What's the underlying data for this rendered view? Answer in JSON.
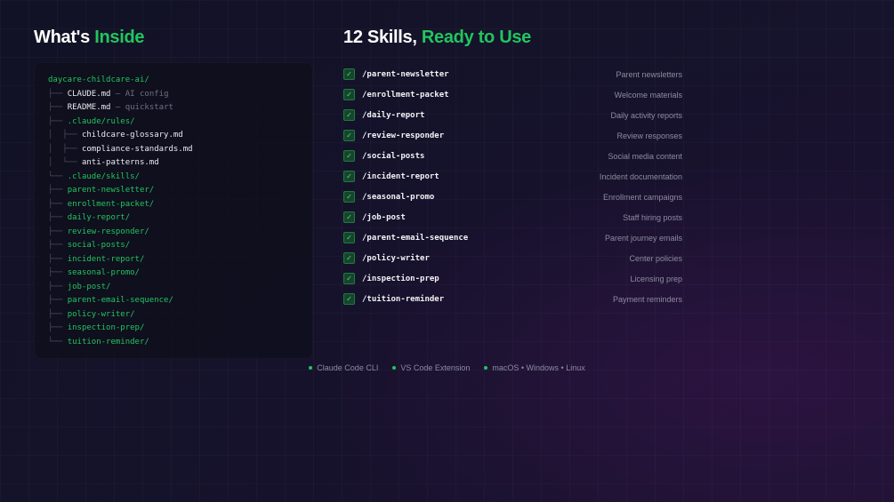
{
  "left_heading": {
    "plain": "What's",
    "accent": "Inside"
  },
  "right_heading": {
    "plain": "12 Skills,",
    "accent": "Ready to Use"
  },
  "tree": [
    {
      "prefix": "",
      "name": "daycare-childcare-ai/",
      "comment": "",
      "style": "root"
    },
    {
      "prefix": "├── ",
      "name": "CLAUDE.md",
      "comment": " — AI config",
      "style": "white"
    },
    {
      "prefix": "├── ",
      "name": "README.md",
      "comment": " — quickstart",
      "style": "white"
    },
    {
      "prefix": "├── ",
      "name": ".claude/rules/",
      "comment": "",
      "style": "green"
    },
    {
      "prefix": "│  ├── ",
      "name": "childcare-glossary.md",
      "comment": "",
      "style": "white"
    },
    {
      "prefix": "│  ├── ",
      "name": "compliance-standards.md",
      "comment": "",
      "style": "white"
    },
    {
      "prefix": "│  └── ",
      "name": "anti-patterns.md",
      "comment": "",
      "style": "white"
    },
    {
      "prefix": "└── ",
      "name": ".claude/skills/",
      "comment": "",
      "style": "green"
    },
    {
      "prefix": "├── ",
      "name": "parent-newsletter/",
      "comment": "",
      "style": "green"
    },
    {
      "prefix": "├── ",
      "name": "enrollment-packet/",
      "comment": "",
      "style": "green"
    },
    {
      "prefix": "├── ",
      "name": "daily-report/",
      "comment": "",
      "style": "green"
    },
    {
      "prefix": "├── ",
      "name": "review-responder/",
      "comment": "",
      "style": "green"
    },
    {
      "prefix": "├── ",
      "name": "social-posts/",
      "comment": "",
      "style": "green"
    },
    {
      "prefix": "├── ",
      "name": "incident-report/",
      "comment": "",
      "style": "green"
    },
    {
      "prefix": "├── ",
      "name": "seasonal-promo/",
      "comment": "",
      "style": "green"
    },
    {
      "prefix": "├── ",
      "name": "job-post/",
      "comment": "",
      "style": "green"
    },
    {
      "prefix": "├── ",
      "name": "parent-email-sequence/",
      "comment": "",
      "style": "green"
    },
    {
      "prefix": "├── ",
      "name": "policy-writer/",
      "comment": "",
      "style": "green"
    },
    {
      "prefix": "├── ",
      "name": "inspection-prep/",
      "comment": "",
      "style": "green"
    },
    {
      "prefix": "└── ",
      "name": "tuition-reminder/",
      "comment": "",
      "style": "green"
    }
  ],
  "skills": [
    {
      "cmd": "/parent-newsletter",
      "desc": "Parent newsletters"
    },
    {
      "cmd": "/enrollment-packet",
      "desc": "Welcome materials"
    },
    {
      "cmd": "/daily-report",
      "desc": "Daily activity reports"
    },
    {
      "cmd": "/review-responder",
      "desc": "Review responses"
    },
    {
      "cmd": "/social-posts",
      "desc": "Social media content"
    },
    {
      "cmd": "/incident-report",
      "desc": "Incident documentation"
    },
    {
      "cmd": "/seasonal-promo",
      "desc": "Enrollment campaigns"
    },
    {
      "cmd": "/job-post",
      "desc": "Staff hiring posts"
    },
    {
      "cmd": "/parent-email-sequence",
      "desc": "Parent journey emails"
    },
    {
      "cmd": "/policy-writer",
      "desc": "Center policies"
    },
    {
      "cmd": "/inspection-prep",
      "desc": "Licensing prep"
    },
    {
      "cmd": "/tuition-reminder",
      "desc": "Payment reminders"
    }
  ],
  "check_glyph": "✓",
  "footer": [
    "Claude Code CLI",
    "VS Code Extension",
    "macOS • Windows • Linux"
  ],
  "colors": {
    "accent": "#22c55e",
    "background": "#14132a",
    "panel": "#0e0e1a"
  },
  "icons": {
    "check": "check-icon",
    "bullet": "bullet-dot-icon"
  }
}
